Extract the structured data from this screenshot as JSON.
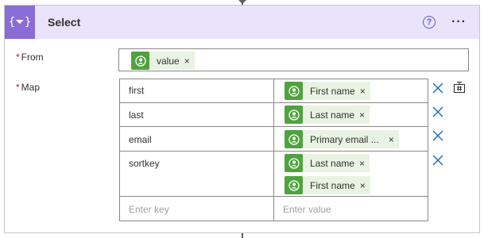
{
  "card": {
    "title": "Select",
    "action_icon": "{⏷}",
    "help_icon": "?",
    "more_icon": "···"
  },
  "from": {
    "required_mark": "*",
    "label": "From",
    "token": {
      "label": "value",
      "icon": "dynamic-content-user-icon",
      "remove": "×"
    }
  },
  "map": {
    "required_mark": "*",
    "label": "Map",
    "rows": [
      {
        "key": "first",
        "tokens": [
          {
            "label": "First name",
            "remove": "×"
          }
        ]
      },
      {
        "key": "last",
        "tokens": [
          {
            "label": "Last name",
            "remove": "×"
          }
        ]
      },
      {
        "key": "email",
        "tokens": [
          {
            "label": "Primary email ...",
            "remove": "×"
          }
        ]
      },
      {
        "key": "sortkey",
        "tokens": [
          {
            "label": "Last name",
            "remove": "×"
          },
          {
            "label": "First name",
            "remove": "×"
          }
        ]
      }
    ],
    "key_placeholder": "Enter key",
    "value_placeholder": "Enter value"
  },
  "colors": {
    "header_bg": "#eae3fb",
    "action_icon_bg": "#8a6cd6",
    "token_bg": "#e9f3e3",
    "token_icon_bg": "#4fa33e",
    "delete_icon": "#0f6cbd"
  }
}
